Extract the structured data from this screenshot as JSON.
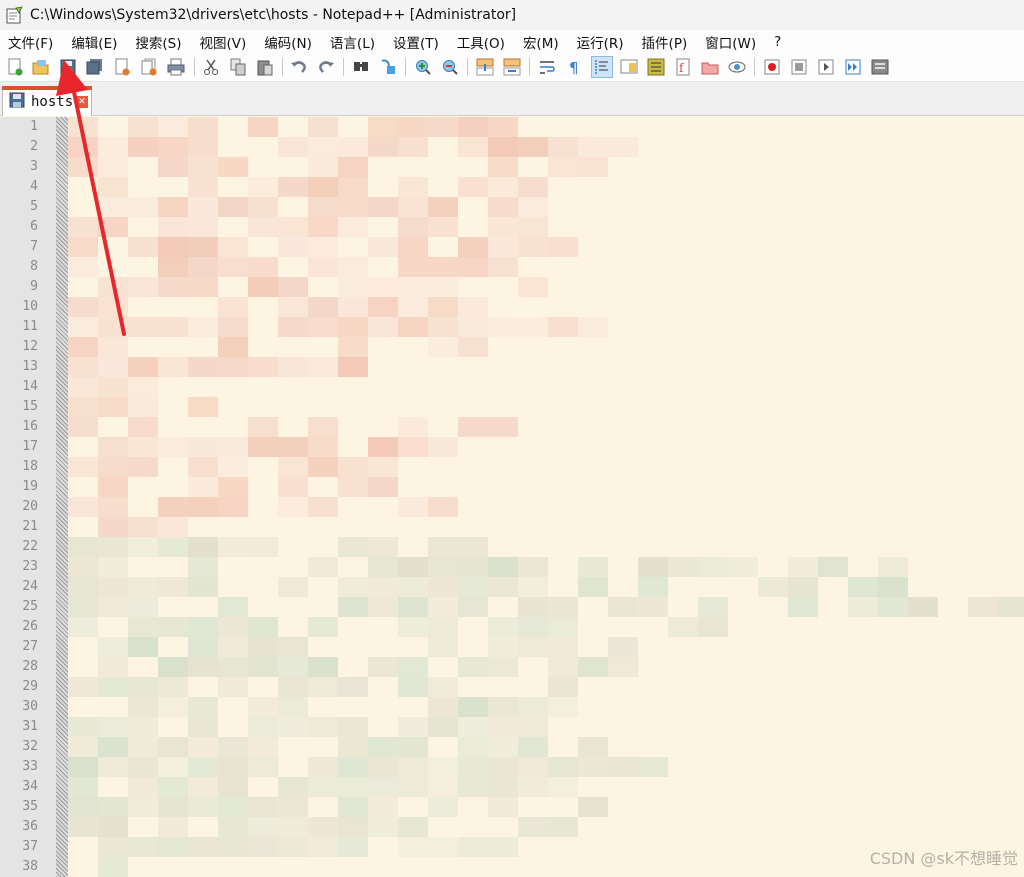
{
  "window": {
    "title": "C:\\Windows\\System32\\drivers\\etc\\hosts - Notepad++ [Administrator]"
  },
  "menu": [
    "文件(F)",
    "编辑(E)",
    "搜索(S)",
    "视图(V)",
    "编码(N)",
    "语言(L)",
    "设置(T)",
    "工具(O)",
    "宏(M)",
    "运行(R)",
    "插件(P)",
    "窗口(W)",
    "?"
  ],
  "toolbar": {
    "buttons": [
      "new-file-icon",
      "open-file-icon",
      "save-icon",
      "save-all-icon",
      "close-file-icon",
      "close-all-icon",
      "print-icon",
      "cut-icon",
      "copy-icon",
      "paste-icon",
      "undo-icon",
      "redo-icon",
      "find-icon",
      "replace-icon",
      "zoom-in-icon",
      "zoom-out-icon",
      "sync-vertical-icon",
      "sync-horizontal-icon",
      "word-wrap-icon",
      "show-all-chars-icon",
      "indent-guide-icon",
      "doc-map-icon",
      "function-list-icon",
      "folder-workspace-icon",
      "doc-panel-icon",
      "monitor-icon",
      "record-macro-icon",
      "stop-macro-icon",
      "play-macro-icon",
      "run-macro-multiple-icon",
      "save-macro-icon"
    ]
  },
  "tab": {
    "label": "hosts",
    "accent": "#d9532b"
  },
  "editor": {
    "line_numbers": [
      "1",
      "2",
      "3",
      "4",
      "5",
      "6",
      "7",
      "8",
      "9",
      "10",
      "11",
      "12",
      "13",
      "14",
      "15",
      "16",
      "17",
      "18",
      "19",
      "20",
      "21",
      "22",
      "23",
      "24",
      "25",
      "26",
      "27",
      "28",
      "29",
      "30",
      "31",
      "32",
      "33",
      "34",
      "35",
      "36",
      "37",
      "38"
    ],
    "background": "#fdf4e1",
    "content_note": ""
  },
  "annotation": {
    "arrow_color": "#e8262b"
  },
  "watermark": "CSDN @sk不想睡觉"
}
